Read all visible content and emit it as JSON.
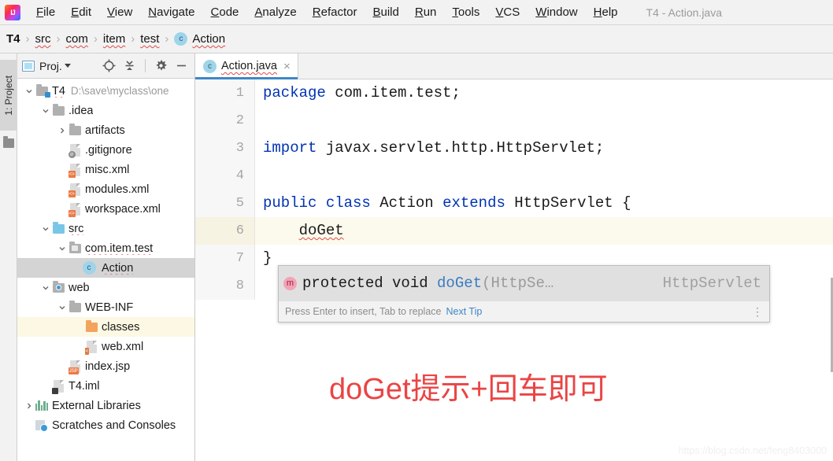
{
  "window": {
    "title": "T4 - Action.java"
  },
  "menubar": {
    "logo": "intellij-idea-logo",
    "items": [
      {
        "label": "File",
        "mnemonic": "F"
      },
      {
        "label": "Edit",
        "mnemonic": "E"
      },
      {
        "label": "View",
        "mnemonic": "V"
      },
      {
        "label": "Navigate",
        "mnemonic": "N"
      },
      {
        "label": "Code",
        "mnemonic": "C"
      },
      {
        "label": "Analyze",
        "mnemonic": "A"
      },
      {
        "label": "Refactor",
        "mnemonic": "R"
      },
      {
        "label": "Build",
        "mnemonic": "B"
      },
      {
        "label": "Run",
        "mnemonic": "R"
      },
      {
        "label": "Tools",
        "mnemonic": "T"
      },
      {
        "label": "VCS",
        "mnemonic": "V"
      },
      {
        "label": "Window",
        "mnemonic": "W"
      },
      {
        "label": "Help",
        "mnemonic": "H"
      }
    ]
  },
  "breadcrumb": {
    "separator": "›",
    "items": [
      {
        "label": "T4",
        "bold": true,
        "icon": ""
      },
      {
        "label": "src",
        "bold": false,
        "icon": ""
      },
      {
        "label": "com",
        "bold": false,
        "icon": ""
      },
      {
        "label": "item",
        "bold": false,
        "icon": ""
      },
      {
        "label": "test",
        "bold": false,
        "icon": ""
      },
      {
        "label": "Action",
        "bold": false,
        "icon": "class-badge"
      }
    ]
  },
  "left_strip": {
    "tool_window_tab": "1: Project",
    "tab_number": "1",
    "folder_icon": "folder-icon"
  },
  "project_panel": {
    "title": "Proj.",
    "toolbar": [
      {
        "name": "locate-icon",
        "tooltip": "Select Opened File"
      },
      {
        "name": "collapse-all-icon",
        "tooltip": "Collapse All"
      },
      {
        "name": "gear-icon",
        "tooltip": "Settings"
      },
      {
        "name": "hide-icon",
        "tooltip": "Hide"
      }
    ],
    "tree": [
      {
        "label": "T4",
        "sub": "D:\\save\\myclass\\one",
        "indent": 0,
        "arrow": "down",
        "icon": "module-folder",
        "state": "normal",
        "wavy": true
      },
      {
        "label": ".idea",
        "sub": "",
        "indent": 1,
        "arrow": "down",
        "icon": "folder-gray",
        "state": "normal",
        "wavy": false
      },
      {
        "label": "artifacts",
        "sub": "",
        "indent": 2,
        "arrow": "right",
        "icon": "folder-gray",
        "state": "normal",
        "wavy": false
      },
      {
        "label": ".gitignore",
        "sub": "",
        "indent": 2,
        "arrow": "none",
        "icon": "file-ignored",
        "state": "normal",
        "wavy": false
      },
      {
        "label": "misc.xml",
        "sub": "",
        "indent": 2,
        "arrow": "none",
        "icon": "file-xml",
        "state": "normal",
        "wavy": false
      },
      {
        "label": "modules.xml",
        "sub": "",
        "indent": 2,
        "arrow": "none",
        "icon": "file-xml",
        "state": "normal",
        "wavy": false
      },
      {
        "label": "workspace.xml",
        "sub": "",
        "indent": 2,
        "arrow": "none",
        "icon": "file-xml",
        "state": "normal",
        "wavy": false
      },
      {
        "label": "src",
        "sub": "",
        "indent": 1,
        "arrow": "down",
        "icon": "folder-source",
        "state": "normal",
        "wavy": true
      },
      {
        "label": "com.item.test",
        "sub": "",
        "indent": 2,
        "arrow": "down",
        "icon": "folder-package",
        "state": "normal",
        "wavy": true
      },
      {
        "label": "Action",
        "sub": "",
        "indent": 3,
        "arrow": "none",
        "icon": "class-badge",
        "state": "selected",
        "wavy": true
      },
      {
        "label": "web",
        "sub": "",
        "indent": 1,
        "arrow": "down",
        "icon": "folder-web",
        "state": "normal",
        "wavy": false
      },
      {
        "label": "WEB-INF",
        "sub": "",
        "indent": 2,
        "arrow": "down",
        "icon": "folder-gray",
        "state": "normal",
        "wavy": false
      },
      {
        "label": "classes",
        "sub": "",
        "indent": 3,
        "arrow": "none",
        "icon": "folder-orange",
        "state": "highlighted",
        "wavy": false
      },
      {
        "label": "web.xml",
        "sub": "",
        "indent": 3,
        "arrow": "none",
        "icon": "file-webxml",
        "state": "normal",
        "wavy": false
      },
      {
        "label": "index.jsp",
        "sub": "",
        "indent": 2,
        "arrow": "none",
        "icon": "file-jsp",
        "state": "normal",
        "wavy": false
      },
      {
        "label": "T4.iml",
        "sub": "",
        "indent": 1,
        "arrow": "none",
        "icon": "file-iml",
        "state": "normal",
        "wavy": false
      },
      {
        "label": "External Libraries",
        "sub": "",
        "indent": 0,
        "arrow": "right",
        "icon": "libraries",
        "state": "normal",
        "wavy": false
      },
      {
        "label": "Scratches and Consoles",
        "sub": "",
        "indent": 0,
        "arrow": "none",
        "icon": "scratches",
        "state": "normal",
        "wavy": false
      }
    ]
  },
  "editor": {
    "tab": {
      "label": "Action.java",
      "icon": "class-badge",
      "close": "×",
      "active": true
    },
    "lines": [
      {
        "no": "1",
        "current": false,
        "tokens": [
          {
            "t": "package",
            "c": "kw"
          },
          {
            "t": " com.item.test;",
            "c": ""
          }
        ]
      },
      {
        "no": "2",
        "current": false,
        "tokens": []
      },
      {
        "no": "3",
        "current": false,
        "tokens": [
          {
            "t": "import",
            "c": "kw"
          },
          {
            "t": " javax.servlet.http.HttpServlet;",
            "c": ""
          }
        ]
      },
      {
        "no": "4",
        "current": false,
        "tokens": []
      },
      {
        "no": "5",
        "current": false,
        "tokens": [
          {
            "t": "public",
            "c": "kw"
          },
          {
            "t": " ",
            "c": ""
          },
          {
            "t": "class",
            "c": "kw"
          },
          {
            "t": " Action ",
            "c": ""
          },
          {
            "t": "extends",
            "c": "kw"
          },
          {
            "t": " HttpServlet {",
            "c": ""
          }
        ]
      },
      {
        "no": "6",
        "current": true,
        "tokens": [
          {
            "t": "    ",
            "c": ""
          },
          {
            "t": "doGet",
            "c": "err"
          }
        ]
      },
      {
        "no": "7",
        "current": false,
        "tokens": [
          {
            "t": "}",
            "c": ""
          }
        ]
      },
      {
        "no": "8",
        "current": false,
        "tokens": []
      }
    ]
  },
  "completion_popup": {
    "icon": "method-icon",
    "icon_letter": "m",
    "signature_prefix": "protected void ",
    "method_name": "doGet",
    "signature_suffix": "(HttpSe…",
    "owner": "HttpServlet",
    "footer_hint": "Press Enter to insert, Tab to replace",
    "footer_link": "Next Tip",
    "footer_menu": "more-options-icon"
  },
  "annotation": {
    "text": "doGet提示+回车即可",
    "color": "#eb4444"
  },
  "watermark": {
    "text": "https://blog.csdn.net/feng8403000"
  }
}
